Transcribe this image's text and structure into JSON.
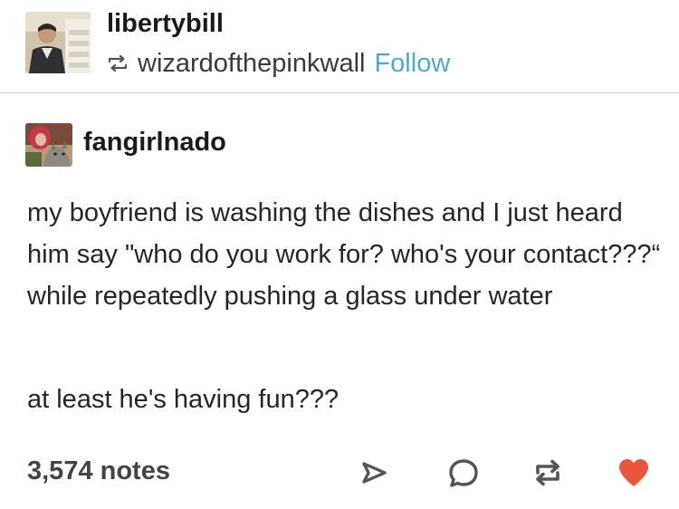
{
  "reblogger": {
    "username": "libertybill",
    "reblogged_from": "wizardofthepinkwall",
    "follow_label": "Follow"
  },
  "original_post": {
    "username": "fangirlnado",
    "paragraphs": [
      "my boyfriend is washing the dishes and I just heard him say \"who do you work for? who's your contact???“ while repeatedly pushing a glass under water",
      "at least he's having fun???"
    ]
  },
  "footer": {
    "notes": "3,574 notes",
    "actions": [
      "share-icon",
      "reply-icon",
      "reblog-icon",
      "heart-icon"
    ]
  },
  "colors": {
    "follow_link": "#53a7c7",
    "like_heart": "#e8573b",
    "divider": "#c9c9c9",
    "text": "#262626"
  }
}
